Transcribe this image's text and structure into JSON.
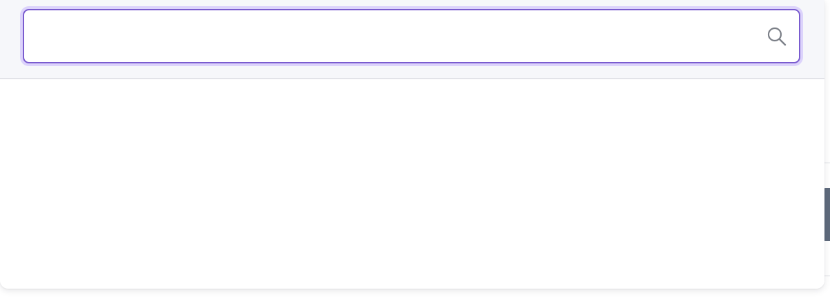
{
  "search": {
    "value": "",
    "placeholder": ""
  },
  "icons": {
    "search": "search-icon"
  },
  "colors": {
    "focus_border": "#7a5ccf",
    "focus_ring": "#dcd3fb",
    "header_background": "#f6f7fa",
    "icon": "#7b7f87",
    "background_tab": "#5f6b7d"
  },
  "results": []
}
